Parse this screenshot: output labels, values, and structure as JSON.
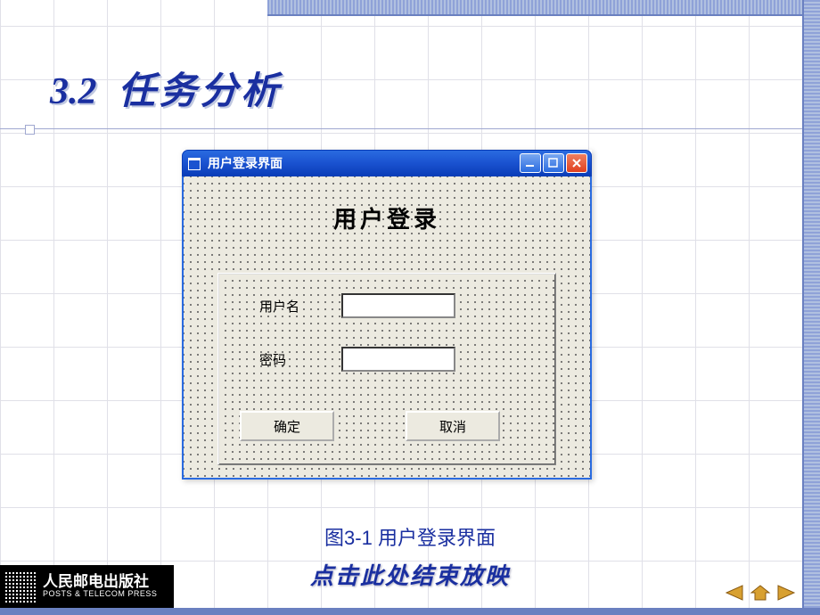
{
  "slide": {
    "section_number": "3.2",
    "section_title": "任务分析",
    "caption": "图3-1  用户登录界面",
    "end_text": "点击此处结束放映"
  },
  "vb_window": {
    "title": "用户登录界面",
    "form_header": "用户登录",
    "labels": {
      "username": "用户名",
      "password": "密码"
    },
    "buttons": {
      "ok": "确定",
      "cancel": "取消"
    }
  },
  "publisher": {
    "cn": "人民邮电出版社",
    "en": "POSTS & TELECOM PRESS"
  }
}
